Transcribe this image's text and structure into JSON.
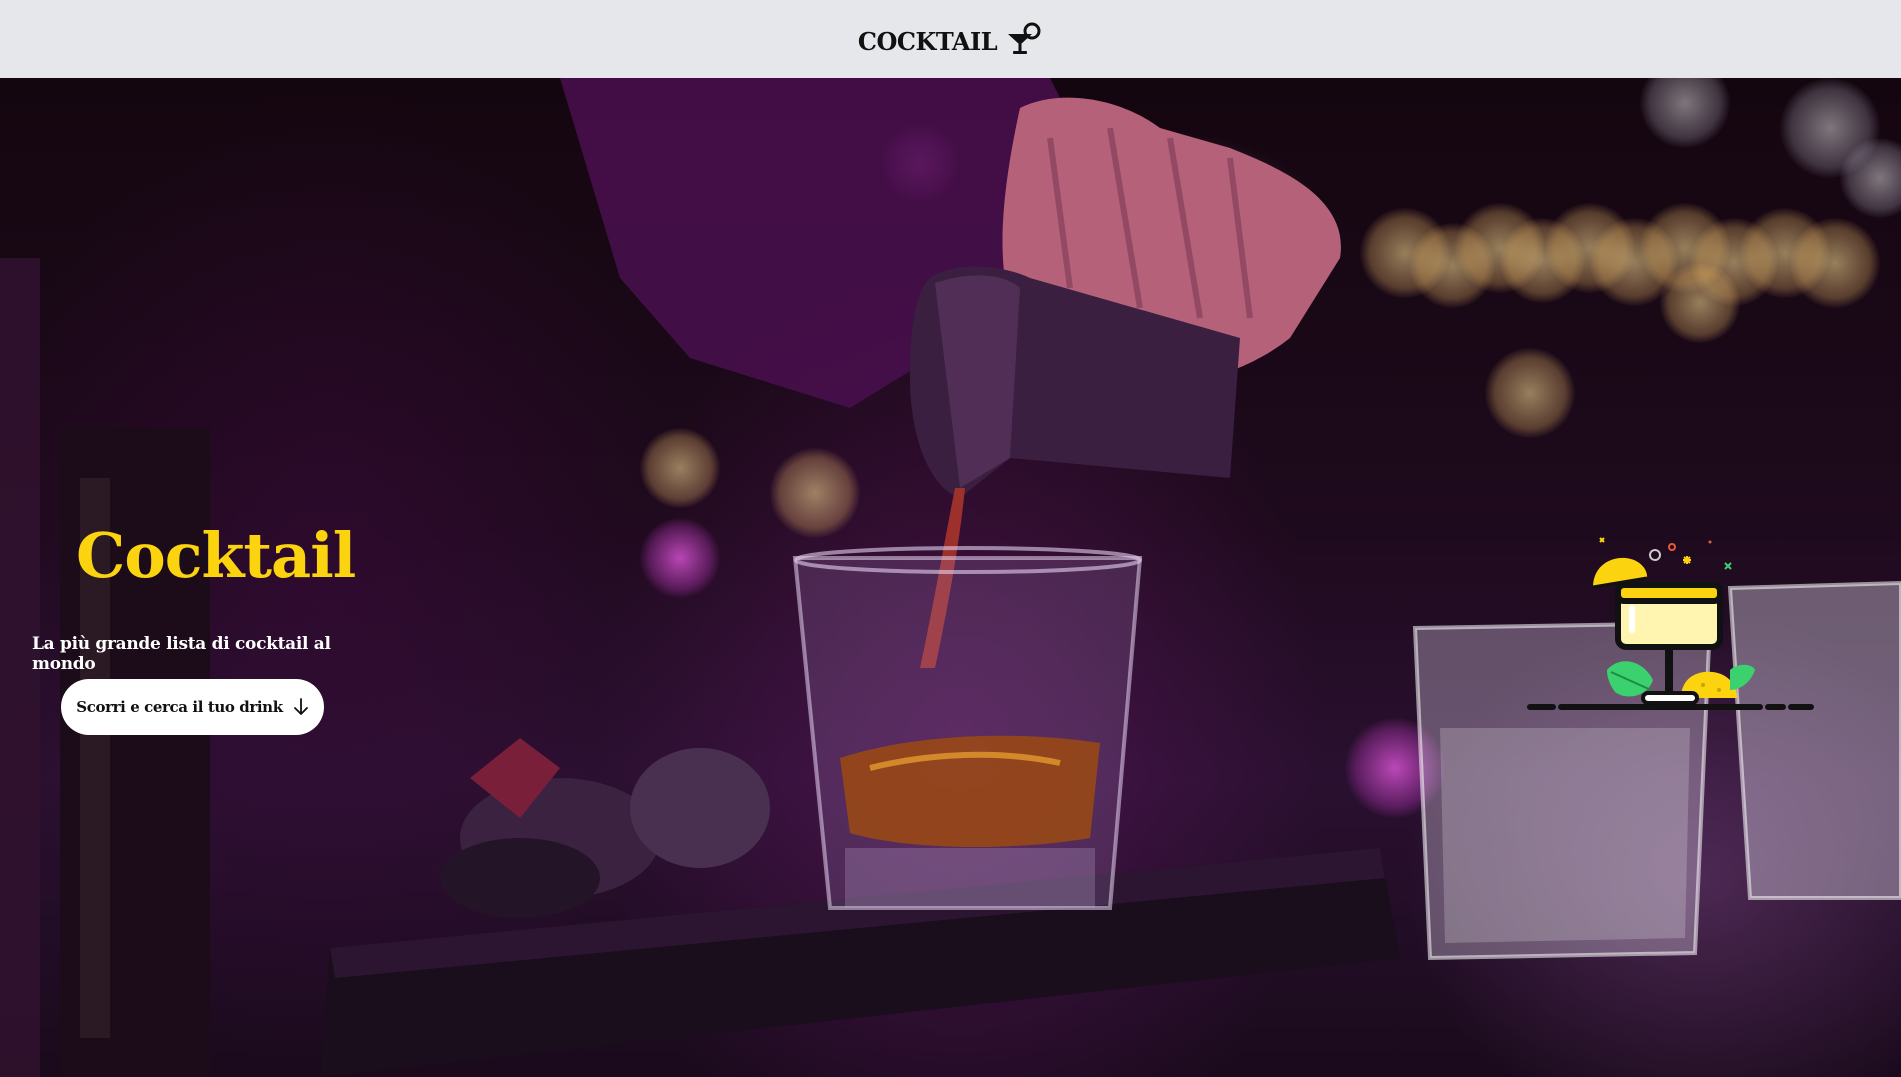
{
  "header": {
    "brand": "COCKTAIL",
    "brand_icon": "cocktail-glass-icon",
    "background": "#e5e7eb"
  },
  "hero": {
    "title": "Cocktail",
    "subtitle": "La più grande lista di cocktail al mondo",
    "cta_label": "Scorri e cerca il tuo drink",
    "cta_icon": "arrow-down-icon",
    "background_image": "bartender-pouring-whiskey-photo",
    "illustration": "cocktail-illustration-icon",
    "colors": {
      "accent": "#fcd30f",
      "text": "#ffffff",
      "button_bg": "#ffffff",
      "overlay": "#6b1a6b"
    }
  }
}
